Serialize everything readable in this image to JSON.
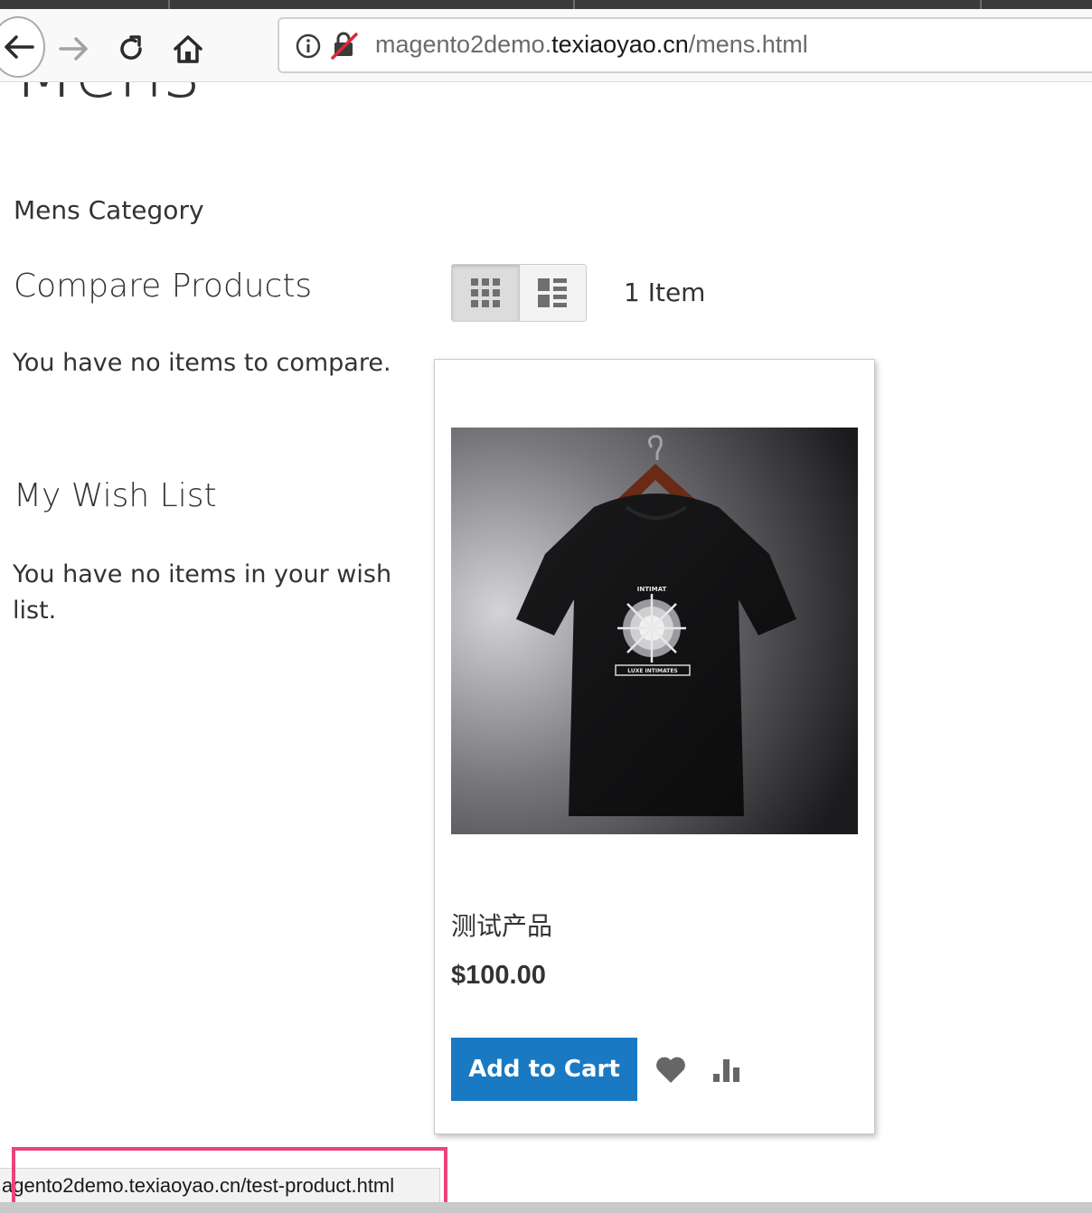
{
  "browser": {
    "url_prefix": "magento2demo.",
    "url_host": "texiaoyao.cn",
    "url_path": "/mens.html",
    "status_url": "agento2demo.texiaoyao.cn/test-product.html",
    "icons": {
      "back": "arrow-left-icon",
      "forward": "arrow-right-icon",
      "reload": "reload-icon",
      "home": "home-icon",
      "info": "info-icon",
      "insecure": "insecure-lock-icon"
    },
    "highlight_color": "#e8457c"
  },
  "page": {
    "heading": "Mens"
  },
  "sidebar": {
    "category_title": "Mens Category",
    "compare_title": "Compare Products",
    "compare_empty": "You have no items to compare.",
    "wishlist_title": "My Wish List",
    "wishlist_empty": "You have no items in your wish list."
  },
  "toolbar": {
    "view_modes": [
      "grid",
      "list"
    ],
    "active_mode": "grid",
    "item_count": "1 Item"
  },
  "product": {
    "image_alt": "black t-shirt on hanger",
    "shirt_text_top": "INTIMAT",
    "shirt_text_bottom": "LUXE INTIMATES",
    "name": "测试产品",
    "price": "$100.00",
    "add_to_cart_label": "Add to Cart",
    "accent_color": "#1979c3"
  }
}
